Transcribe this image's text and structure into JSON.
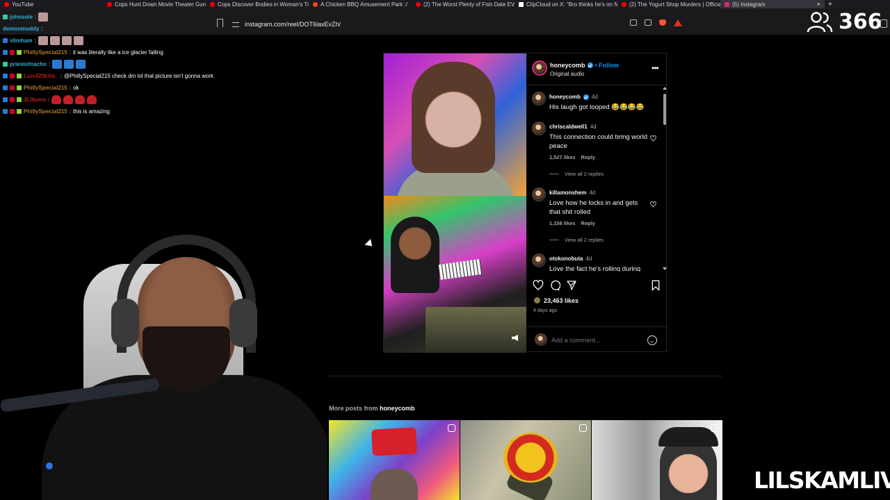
{
  "browser": {
    "tabs": [
      {
        "title": "YouTube",
        "icon": "youtube-icon"
      },
      {
        "title": "Cops Hunt Down Movie Theater Gun",
        "icon": "youtube-icon"
      },
      {
        "title": "Cops Discover Bodies in Woman's Tr",
        "icon": "youtube-icon"
      },
      {
        "title": "A Chicken BBQ Amusement Park :/",
        "icon": "reddit-icon"
      },
      {
        "title": "(2) The Worst Plenty of Fish Date EV",
        "icon": "youtube-icon"
      },
      {
        "title": "ClipCloud on X: \"Bro thinks he's on N",
        "icon": "x-icon"
      },
      {
        "title": "(2) The Yogurt Shop Murders | Officia",
        "icon": "youtube-icon"
      },
      {
        "title": "(5) Instagram",
        "icon": "instagram-icon",
        "active": true
      }
    ],
    "close_tab": "×",
    "new_tab": "+",
    "url": "instagram.com/reel/DOT6laxEvZh/"
  },
  "stream_overlay": {
    "viewer_count": "366",
    "watermark": "LILSKAMLIVE"
  },
  "chat": [
    {
      "user": "johnsole",
      "color": "#2fb1d6",
      "message": "",
      "emotes": 1
    },
    {
      "user": "demonmuddy",
      "color": "#2fb1d6",
      "message": "",
      "emotes": 0
    },
    {
      "user": "slimham",
      "color": "#2fb1d6",
      "message": "",
      "emotes": 4
    },
    {
      "user": "PhillySpecial215",
      "color": "#b07a2a",
      "message": "it was literally like a ice glacier falling",
      "emotes": 0
    },
    {
      "user": "priestofnacho",
      "color": "#2fb1d6",
      "message": "",
      "emotes": 3
    },
    {
      "user": "Luis420killa_",
      "color": "#b51d1d",
      "message": "@PhillySpecial215 check dm lol that picture isn't gonna work",
      "emotes": 0
    },
    {
      "user": "PhillySpecial215",
      "color": "#b07a2a",
      "message": "ok",
      "emotes": 0
    },
    {
      "user": "3L0jama",
      "color": "#b51d1d",
      "message": "",
      "emotes": 4
    },
    {
      "user": "PhillySpecial215",
      "color": "#b07a2a",
      "message": "this is amazing",
      "emotes": 0
    }
  ],
  "post": {
    "header": {
      "username": "honeycomb",
      "follow_label": "• Follow",
      "audio": "Original audio"
    },
    "comments": [
      {
        "user": "honeycomb",
        "verified": true,
        "time": "4d",
        "text": "His laugh got looped 😂😂😂😂",
        "likes": "",
        "reply": "",
        "replies": ""
      },
      {
        "user": "chriscaldwell1",
        "verified": false,
        "time": "4d",
        "text": "This connection could bring world peace",
        "likes": "1,527 likes",
        "reply": "Reply",
        "replies": "View all 2 replies"
      },
      {
        "user": "killamonshem",
        "verified": false,
        "time": "4d",
        "text": "Love how he locks in and gets that shit rolled",
        "likes": "1,158 likes",
        "reply": "Reply",
        "replies": "View all 2 replies"
      },
      {
        "user": "otokonobuta",
        "verified": false,
        "time": "4d",
        "text": "Love the fact he's rolling during",
        "likes": "",
        "reply": "",
        "replies": ""
      }
    ],
    "likes": "23,463 likes",
    "posted": "4 days ago",
    "add_comment_placeholder": "Add a comment..."
  },
  "more_posts": {
    "prefix": "More posts from",
    "user": "honeycomb"
  },
  "colors": {
    "accent_blue": "#0095f6",
    "instagram_border": "#262626",
    "muted_text": "#a8a8a8"
  }
}
